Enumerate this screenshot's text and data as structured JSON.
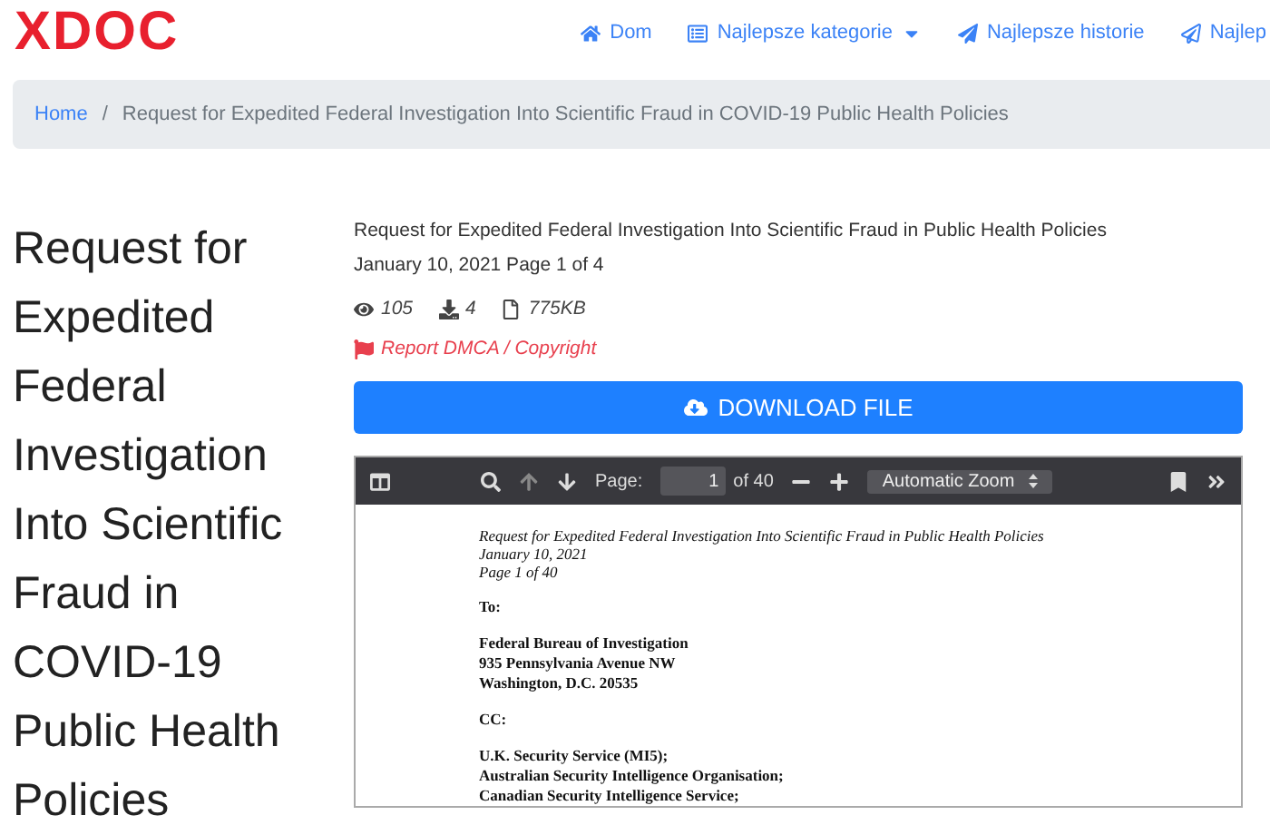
{
  "logo": "XDOC",
  "nav": [
    {
      "label": "Dom",
      "kind": "home"
    },
    {
      "label": "Najlepsze kategorie",
      "kind": "dropdown"
    },
    {
      "label": "Najlepsze historie",
      "kind": "send"
    },
    {
      "label": "Najlep",
      "kind": "send-outline"
    }
  ],
  "breadcrumb": {
    "home": "Home",
    "separator": "/",
    "current": "Request for Expedited Federal Investigation Into Scientific Fraud in COVID-19 Public Health Policies"
  },
  "title": "Request for Expedited Federal Investigation Into Scientific Fraud in COVID-19 Public Health Policies",
  "summary": [
    "Request for Expedited Federal Investigation Into Scientific Fraud in Public Health Policies",
    "January 10, 2021 Page 1 of 4"
  ],
  "stats": [
    {
      "kind": "views",
      "value": "105"
    },
    {
      "kind": "downloads",
      "value": "4"
    },
    {
      "kind": "size",
      "value": "775KB"
    }
  ],
  "report_link": "Report DMCA / Copyright",
  "download_button": "DOWNLOAD FILE",
  "viewer": {
    "page_label": "Page:",
    "page_value": "1",
    "page_total": "of 40",
    "zoom": "Automatic Zoom",
    "header_lines": [
      "Request for Expedited Federal Investigation Into Scientific Fraud in Public Health Policies",
      "January 10, 2021",
      "Page 1 of 40"
    ],
    "blocks": [
      [
        "To:"
      ],
      [
        "Federal Bureau of Investigation",
        "935 Pennsylvania Avenue NW",
        "Washington, D.C. 20535"
      ],
      [
        "CC:"
      ],
      [
        "U.K. Security Service (MI5);",
        "Australian Security Intelligence Organisation;",
        "Canadian Security Intelligence Service;"
      ]
    ]
  }
}
